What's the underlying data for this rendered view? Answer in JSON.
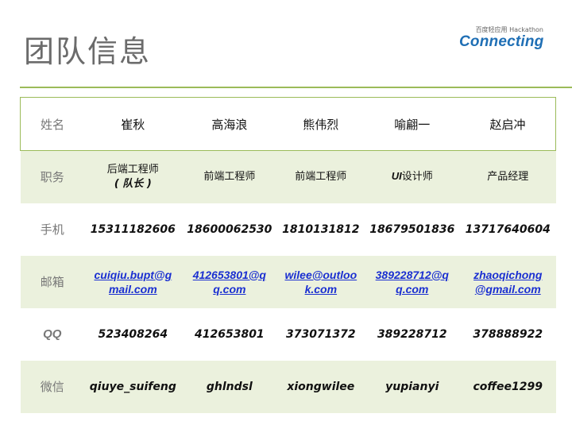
{
  "title": "团队信息",
  "logo": {
    "tagline": "百度轻应用 Hackathon",
    "brand": "Connecting"
  },
  "table": {
    "row_labels": {
      "name": "姓名",
      "role": "职务",
      "phone": "手机",
      "email": "邮箱",
      "qq": "QQ",
      "wechat": "微信"
    },
    "members": [
      {
        "name": "崔秋",
        "role_line1": "后端工程师",
        "role_line2": "( 队长 )",
        "phone": "15311182606",
        "email_line1": "cuiqiu.bupt@g",
        "email_line2": "mail.com",
        "qq": "523408264",
        "wechat": "qiuye_suifeng"
      },
      {
        "name": "高海浪",
        "role": "前端工程师",
        "phone": "18600062530",
        "email_line1": "412653801@q",
        "email_line2": "q.com",
        "qq": "412653801",
        "wechat": "ghlndsl"
      },
      {
        "name": "熊伟烈",
        "role": "前端工程师",
        "phone": "1810131812",
        "email_line1": "wilee@outloo",
        "email_line2": "k.com",
        "qq": "373071372",
        "wechat": "xiongwilee"
      },
      {
        "name": "喻翩一",
        "role_prefix": "UI",
        "role_rest": "设计师",
        "phone": "18679501836",
        "email_line1": "389228712@q",
        "email_line2": "q.com",
        "qq": "389228712",
        "wechat": "yupianyi"
      },
      {
        "name": "赵启冲",
        "role": "产品经理",
        "phone": "13717640604",
        "email_line1": "zhaoqichong",
        "email_line2": "@gmail.com",
        "qq": "378888922",
        "wechat": "coffee1299"
      }
    ]
  },
  "colors": {
    "accent_green": "#9bbb59",
    "shade_green": "#ebf1dd",
    "link_blue": "#1a2fd1",
    "title_gray": "#6b6b6b"
  }
}
